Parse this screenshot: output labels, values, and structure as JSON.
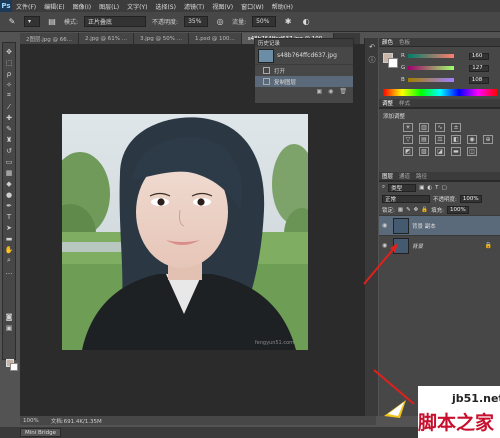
{
  "app": {
    "logo": "Ps"
  },
  "menu": [
    "文件(F)",
    "编辑(E)",
    "图像(I)",
    "图层(L)",
    "文字(Y)",
    "选择(S)",
    "滤镜(T)",
    "视图(V)",
    "窗口(W)",
    "帮助(H)"
  ],
  "options": {
    "mode_label": "模式:",
    "mode_value": "正片叠底",
    "opacity_label": "不透明度:",
    "opacity_value": "35%",
    "flow_label": "流量:",
    "flow_value": "50%"
  },
  "tabs": [
    {
      "label": "2图层.jpg @ 66...",
      "active": false
    },
    {
      "label": "2.jpg @ 61% ...",
      "active": false
    },
    {
      "label": "3.jpg @ 50% ...",
      "active": false
    },
    {
      "label": "1.psd @ 100...",
      "active": false
    },
    {
      "label": "s48b764ffcd637.jpg @ 100...",
      "active": true
    }
  ],
  "history": {
    "title": "历史记录",
    "snapshot": "s48b764ffcd637.jpg",
    "items": [
      {
        "label": "打开",
        "active": false
      },
      {
        "label": "复制图层",
        "active": true
      }
    ]
  },
  "color_panel": {
    "tabs": [
      "颜色",
      "色板"
    ],
    "channels": [
      {
        "name": "R",
        "value": "160"
      },
      {
        "name": "G",
        "value": "127"
      },
      {
        "name": "B",
        "value": "108"
      }
    ],
    "foreground": "#c9b5a8"
  },
  "adjustments": {
    "tabs": [
      "调整",
      "样式"
    ],
    "title": "添加调整"
  },
  "layers": {
    "tabs": [
      "图层",
      "通道",
      "路径"
    ],
    "filter": "类型",
    "blend": "正常",
    "opacity_label": "不透明度:",
    "opacity_value": "100%",
    "lock_label": "锁定:",
    "fill_label": "填充:",
    "fill_value": "100%",
    "items": [
      {
        "name": "背景 副本",
        "active": true
      },
      {
        "name": "背景",
        "active": false
      }
    ]
  },
  "status": {
    "zoom": "100%",
    "doc": "文档:691.4K/1.35M"
  },
  "bottom": {
    "bridge": "Mini Bridge"
  },
  "photo_credit": "fengyun51.com",
  "watermark": {
    "url": "jb51.net",
    "cn": "脚本之家"
  }
}
